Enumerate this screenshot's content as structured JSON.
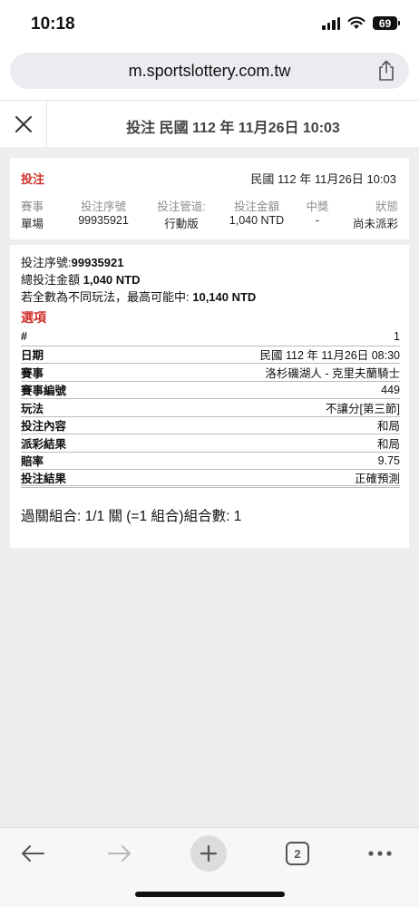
{
  "status": {
    "time": "10:18",
    "battery": "69"
  },
  "browser": {
    "url": "m.sportslottery.com.tw",
    "tab_count": "2"
  },
  "header": {
    "title": "投注 民國 112 年 11月26日 10:03"
  },
  "summary": {
    "title": "投注",
    "date": "民國 112 年 11月26日 10:03",
    "columns": [
      "賽事",
      "投注序號",
      "投注管道:",
      "投注金額",
      "中獎",
      "狀態"
    ],
    "values": [
      "單場",
      "99935921",
      "行動版",
      "1,040 NTD",
      "-",
      "尚未派彩"
    ]
  },
  "detail": {
    "serial_label": "投注序號:",
    "serial_value": "99935921",
    "total_label": "總投注金額 ",
    "total_value": "1,040 NTD",
    "max_label": "若全數為不同玩法，最高可能中: ",
    "max_value": "10,140 NTD",
    "options_title": "選項",
    "rows": [
      {
        "key": "#",
        "value": "1"
      },
      {
        "key": "日期",
        "value": "民國 112 年 11月26日 08:30"
      },
      {
        "key": "賽事",
        "value": "洛杉磯湖人 - 克里夫蘭騎士"
      },
      {
        "key": "賽事編號",
        "value": "449"
      },
      {
        "key": "玩法",
        "value": "不讓分[第三節]"
      },
      {
        "key": "投注內容",
        "value": "和局"
      },
      {
        "key": "派彩結果",
        "value": "和局"
      },
      {
        "key": "賠率",
        "value": "9.75"
      },
      {
        "key": "投注結果",
        "value": "正確預測"
      }
    ],
    "parlay": "過關組合: 1/1 關 (=1 組合)組合數: 1"
  },
  "icons": {
    "close": "close-icon",
    "share": "share-icon",
    "back": "back-arrow-icon",
    "forward": "forward-arrow-icon",
    "new_tab": "plus-icon",
    "tabs": "tabs-icon",
    "more": "more-icon"
  },
  "colors": {
    "accent_red": "#d0312d",
    "background_gray": "#eeeeee"
  }
}
